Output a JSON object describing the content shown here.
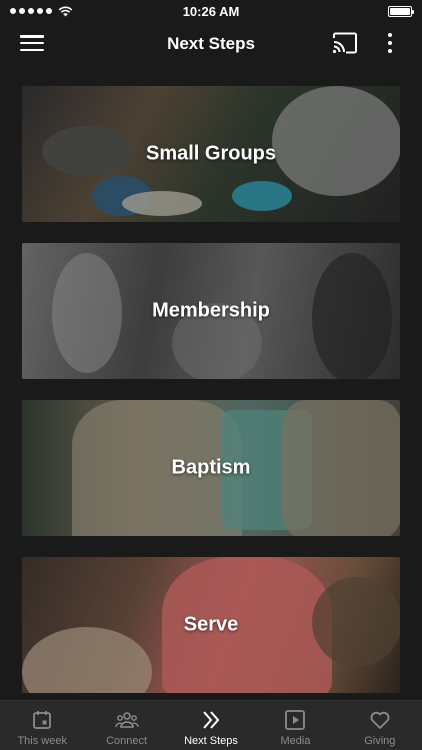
{
  "status_bar": {
    "time": "10:26 AM",
    "signal_bars": 5,
    "battery_level": 1.0
  },
  "nav": {
    "title": "Next Steps",
    "menu_icon": "hamburger-menu-icon",
    "cast_icon": "cast-icon",
    "more_icon": "more-vertical-icon"
  },
  "cards": [
    {
      "title": "Small Groups"
    },
    {
      "title": "Membership"
    },
    {
      "title": "Baptism"
    },
    {
      "title": "Serve"
    }
  ],
  "tab_bar": {
    "tabs": [
      {
        "label": "This week",
        "icon": "calendar-icon",
        "active": false
      },
      {
        "label": "Connect",
        "icon": "people-icon",
        "active": false
      },
      {
        "label": "Next Steps",
        "icon": "double-chevron-right-icon",
        "active": true
      },
      {
        "label": "Media",
        "icon": "play-square-icon",
        "active": false
      },
      {
        "label": "Giving",
        "icon": "heart-icon",
        "active": false
      }
    ]
  },
  "colors": {
    "background": "#1a1a1a",
    "tab_bar": "#2a2a2a",
    "active_tab": "#ffffff",
    "inactive_tab": "#8c8c8c"
  }
}
